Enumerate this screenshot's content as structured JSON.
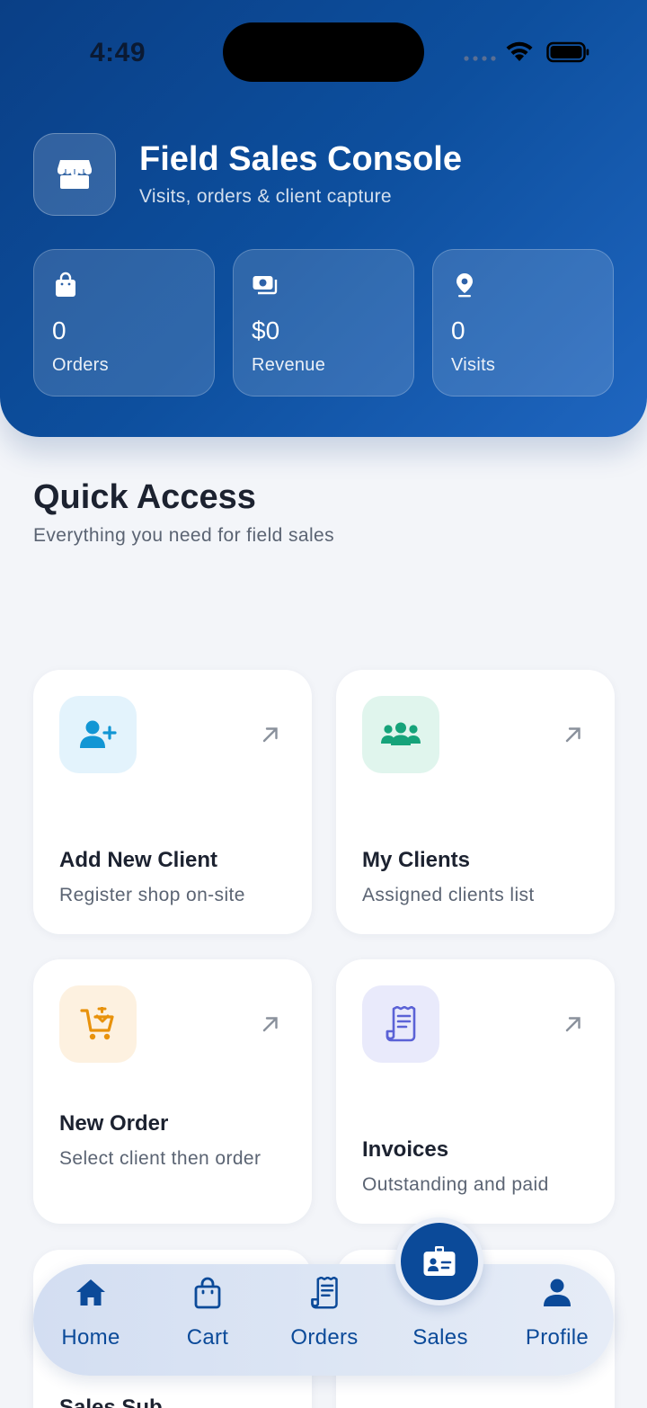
{
  "status_bar": {
    "time": "4:49"
  },
  "header": {
    "title": "Field Sales Console",
    "subtitle": "Visits, orders & client capture",
    "brand_icon": "storefront-icon",
    "gradient": [
      "#0a3f86",
      "#1f66c0"
    ]
  },
  "stats": [
    {
      "icon": "shopping-bag-icon",
      "value": "0",
      "label": "Orders"
    },
    {
      "icon": "money-icon",
      "value": "$0",
      "label": "Revenue"
    },
    {
      "icon": "map-pin-icon",
      "value": "0",
      "label": "Visits"
    }
  ],
  "quick_access": {
    "title": "Quick Access",
    "subtitle": "Everything you need for field sales",
    "tiles": [
      {
        "title": "Add New Client",
        "description": "Register shop on-site",
        "icon": "user-plus-icon",
        "icon_color": "#1296d4",
        "icon_bg": "#e3f3fc"
      },
      {
        "title": "My Clients",
        "description": "Assigned clients list",
        "icon": "users-icon",
        "icon_color": "#16a37a",
        "icon_bg": "#e0f5ed"
      },
      {
        "title": "New Order",
        "description": "Select client then order",
        "icon": "cart-plus-icon",
        "icon_color": "#e8920c",
        "icon_bg": "#fdf1e0"
      },
      {
        "title": "Invoices",
        "description": "Outstanding and paid",
        "icon": "receipt-icon",
        "icon_color": "#5b62d6",
        "icon_bg": "#e9eafb"
      }
    ],
    "partial_tile_text": "Sales Sub"
  },
  "bottom_nav": {
    "items": [
      {
        "label": "Home",
        "icon": "home-icon"
      },
      {
        "label": "Cart",
        "icon": "shopping-bag-icon"
      },
      {
        "label": "Orders",
        "icon": "receipt-icon"
      },
      {
        "label": "Sales",
        "icon": "id-badge-icon"
      },
      {
        "label": "Profile",
        "icon": "user-icon"
      }
    ],
    "active_color": "#0b4a99"
  }
}
